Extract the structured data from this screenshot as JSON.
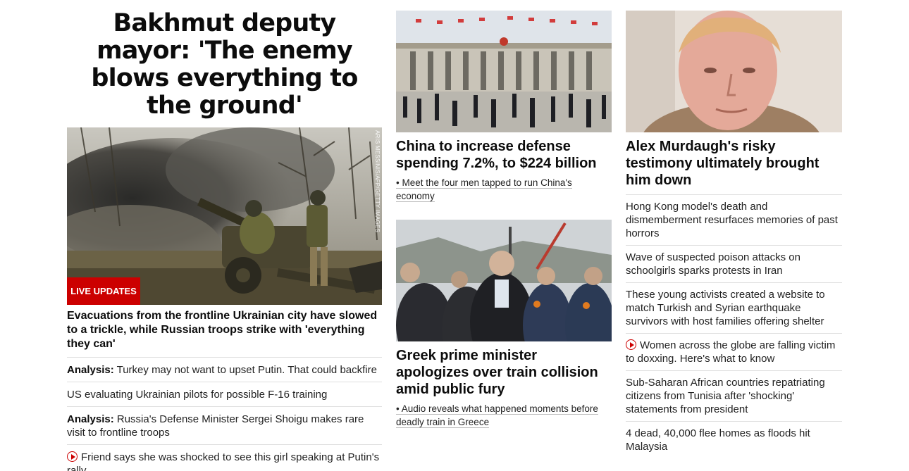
{
  "col1": {
    "headline": "Bakhmut deputy mayor: 'The enemy blows everything to the ground'",
    "image_credit": "ARIS MESSINIS/AFP/GETTY IMAGES",
    "badge": "LIVE UPDATES",
    "lead": "Evacuations from the frontline Ukrainian city have slowed to a trickle, while Russian troops strike with 'everything they can'",
    "items": [
      {
        "prefix": "Analysis:",
        "text": "Turkey may not want to upset Putin. That could backfire"
      },
      {
        "prefix": "",
        "text": "US evaluating Ukrainian pilots for possible F-16 training"
      },
      {
        "prefix": "Analysis:",
        "text": "Russia's Defense Minister Sergei Shoigu makes rare visit to frontline troops"
      },
      {
        "prefix": "",
        "text": "Friend says she was shocked to see this girl speaking at Putin's rally",
        "icon": "play-icon"
      }
    ]
  },
  "col2": {
    "story1": {
      "title": "China to increase defense spending 7.2%, to $224 billion",
      "sublink": "• Meet the four men tapped to run China's economy"
    },
    "story2": {
      "title": "Greek prime minister apologizes over train collision amid public fury",
      "sublink": "• Audio reveals what happened moments before deadly train in Greece"
    }
  },
  "col3": {
    "title": "Alex Murdaugh's risky testimony ultimately brought him down",
    "items": [
      {
        "text": "Hong Kong model's death and dismemberment resurfaces memories of past horrors"
      },
      {
        "text": "Wave of suspected poison attacks on schoolgirls sparks protests in Iran"
      },
      {
        "text": "These young activists created a website to match Turkish and Syrian earthquake survivors with host families offering shelter"
      },
      {
        "text": "Women across the globe are falling victim to doxxing. Here's what to know",
        "icon": "play-icon"
      },
      {
        "text": "Sub-Saharan African countries repatriating citizens from Tunisia after 'shocking' statements from president"
      },
      {
        "text": "4 dead, 40,000 flee homes as floods hit Malaysia"
      }
    ]
  },
  "colors": {
    "accent": "#cc0000",
    "divider": "#dfdfdf"
  }
}
